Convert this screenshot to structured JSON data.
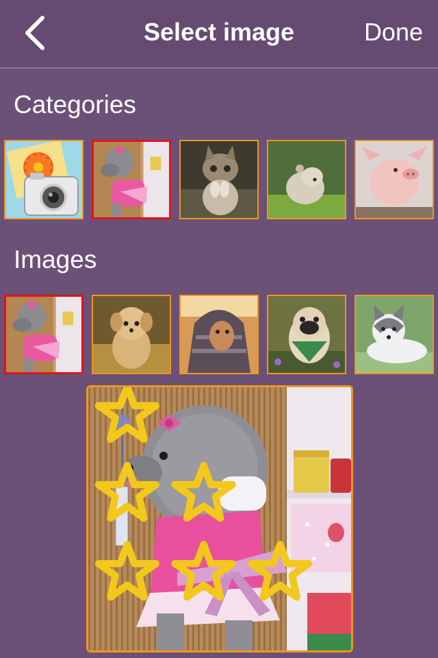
{
  "navbar": {
    "title": "Select image",
    "done_label": "Done",
    "back_icon": "chevron-left-icon"
  },
  "categories": {
    "title": "Categories",
    "items": [
      {
        "name": "camera-flower",
        "icon": "camera-icon",
        "selected": false
      },
      {
        "name": "poodle",
        "selected": true
      },
      {
        "name": "kitten",
        "selected": false
      },
      {
        "name": "hamster",
        "selected": false
      },
      {
        "name": "piglet",
        "selected": false
      }
    ]
  },
  "images": {
    "title": "Images",
    "items": [
      {
        "name": "poodle",
        "selected": true
      },
      {
        "name": "yorkie-puppy",
        "selected": false
      },
      {
        "name": "chihuahua-hoodie",
        "selected": false
      },
      {
        "name": "pug-bandana",
        "selected": false
      },
      {
        "name": "husky-puppy",
        "selected": false
      }
    ]
  },
  "preview": {
    "name": "poodle",
    "star_rows": [
      1,
      2,
      3
    ]
  },
  "colors": {
    "background": "#6b5077",
    "navbar": "#654a71",
    "thumb_border": "#f0961c",
    "selected_border": "#e0141e"
  }
}
